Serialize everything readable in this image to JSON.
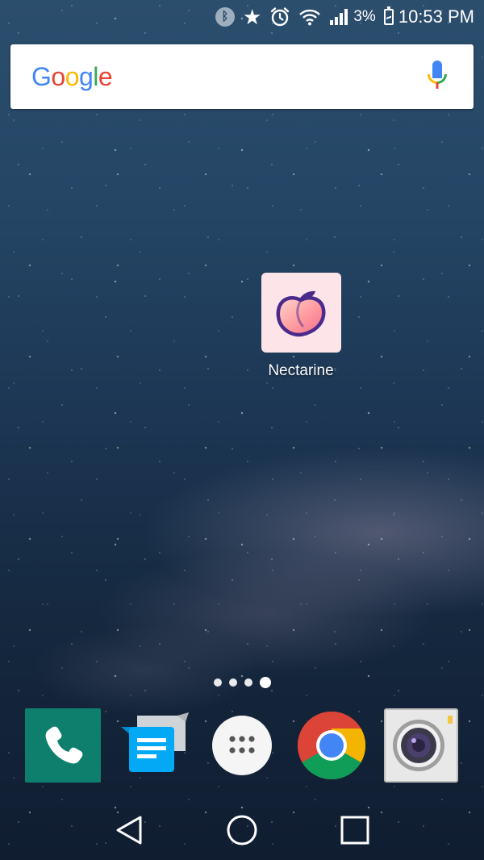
{
  "status_bar": {
    "icons": [
      "bluetooth-icon",
      "star-icon",
      "alarm-icon",
      "wifi-icon",
      "signal-icon",
      "battery-icon"
    ],
    "battery_percent": "3%",
    "time": "10:53 PM"
  },
  "search": {
    "logo_text": "Google",
    "logo_colors": [
      "#4285F4",
      "#EA4335",
      "#FBBC05",
      "#4285F4",
      "#34A853",
      "#EA4335"
    ],
    "mic_icon": "mic-icon"
  },
  "home_apps": [
    {
      "label": "Nectarine",
      "icon": "peach-icon",
      "icon_bg": "#fde4e9"
    }
  ],
  "page_indicator": {
    "pages": 4,
    "current": 4
  },
  "dock": [
    {
      "name": "Phone",
      "icon": "phone-icon"
    },
    {
      "name": "Messages",
      "icon": "messages-icon"
    },
    {
      "name": "Apps",
      "icon": "app-drawer-icon"
    },
    {
      "name": "Chrome",
      "icon": "chrome-icon"
    },
    {
      "name": "Camera",
      "icon": "camera-icon"
    }
  ],
  "nav_bar": [
    "back-icon",
    "home-icon",
    "recents-icon"
  ],
  "colors": {
    "phone_bg": "#0f7f6d",
    "messages_bubble": "#03a9f4",
    "chrome_red": "#db4437",
    "chrome_yellow": "#f4b400",
    "chrome_green": "#0f9d58",
    "chrome_blue": "#4285f4"
  }
}
